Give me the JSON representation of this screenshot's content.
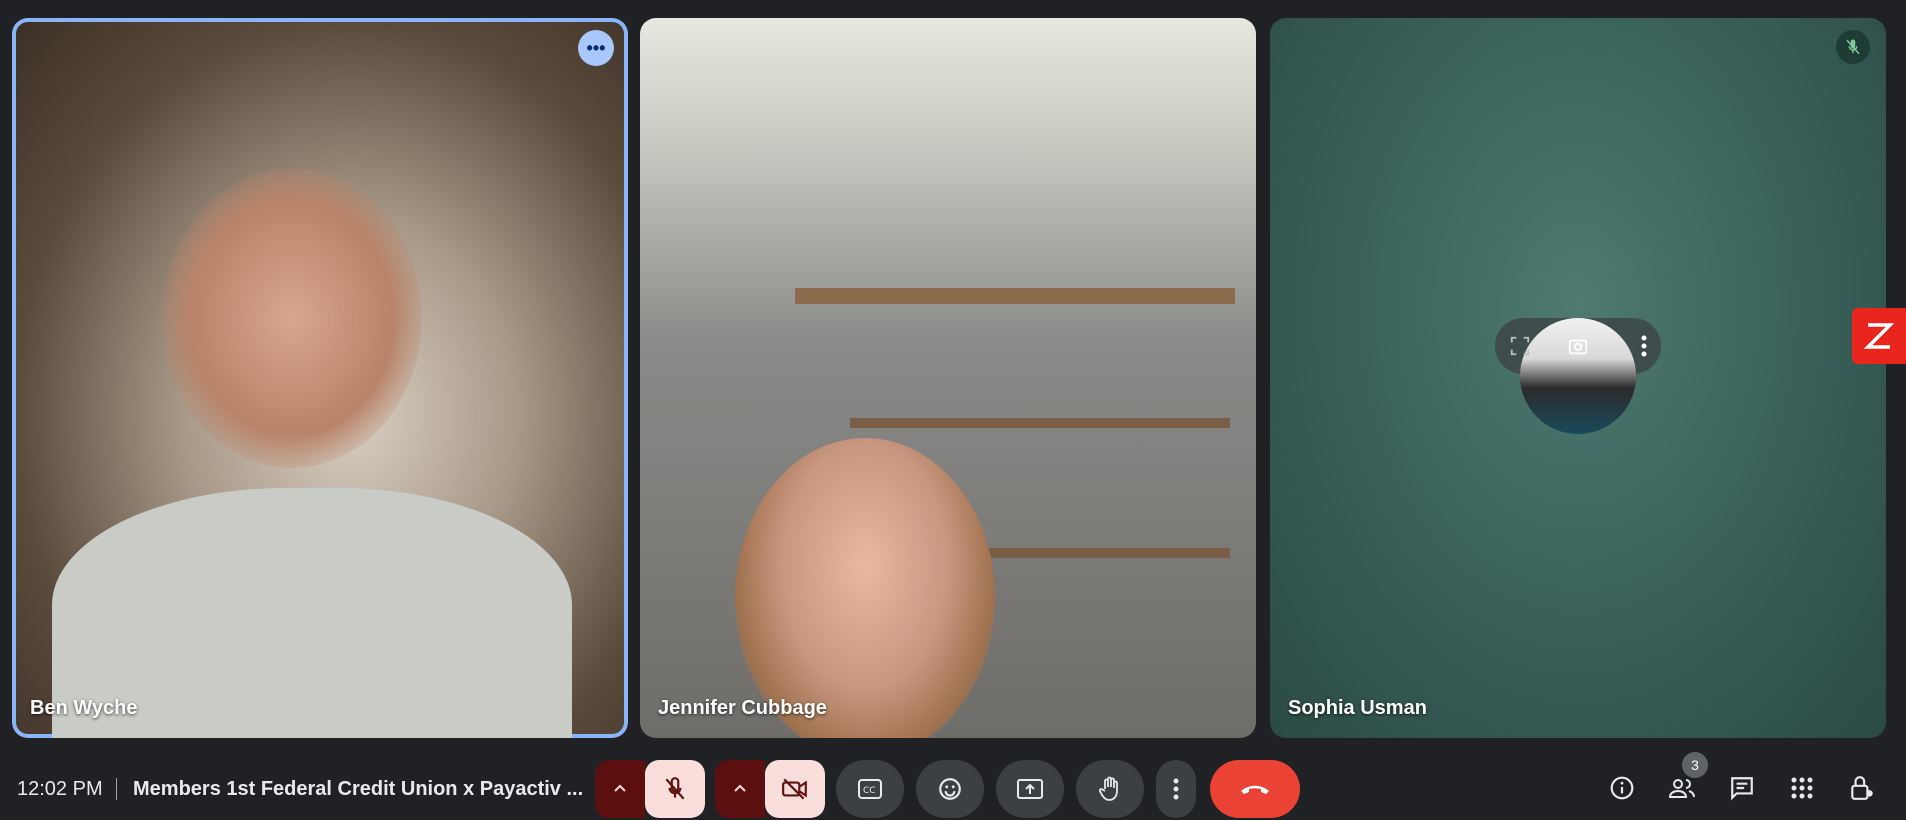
{
  "participants": [
    {
      "name": "Ben Wyche"
    },
    {
      "name": "Jennifer Cubbage"
    },
    {
      "name": "Sophia Usman"
    }
  ],
  "tile_actions": {
    "more_options_icon": "more-horizontal-icon",
    "mic_off_icon": "mic-off-icon"
  },
  "status_bar": {
    "time": "12:02 PM",
    "meeting_title": "Members 1st Federal Credit Union x Payactiv ..."
  },
  "people_count": "3",
  "colors": {
    "active_speaker_border": "#8ab4f8",
    "end_call": "#ea4335",
    "muted_control": "#f9dedc",
    "caret_bg": "#5b0f0f",
    "zoom_badge": "#e8261f"
  }
}
